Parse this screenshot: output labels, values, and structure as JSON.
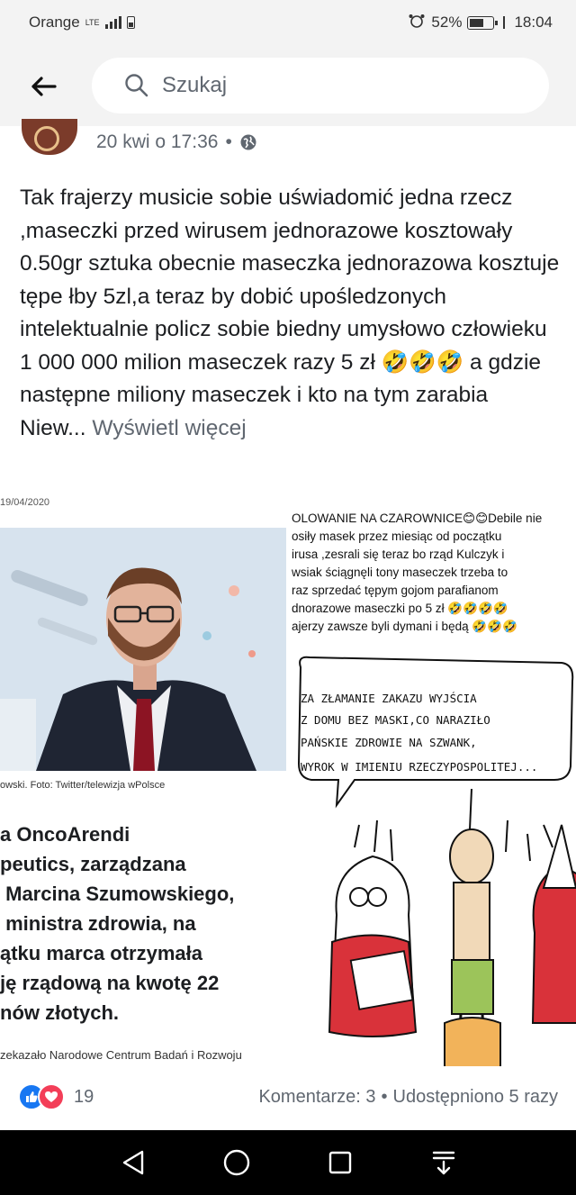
{
  "status_bar": {
    "carrier": "Orange",
    "network": "LTE",
    "battery_percent": "52%",
    "time": "18:04"
  },
  "header": {
    "search_placeholder": "Szukaj"
  },
  "post": {
    "timestamp": "20 kwi o 17:36",
    "separator": "•",
    "text": "Tak frajerzy musicie sobie uświadomić jedna rzecz ,maseczki przed wirusem jednorazowe kosztowały 0.50gr sztuka obecnie maseczka jednorazowa kosztuje tępe łby 5zl,a teraz by dobić upośledzonych intelektualnie policz sobie biedny umysłowo człowieku 1 000 000 milion maseczek razy 5 zł 🤣🤣🤣 a gdzie następne miliony maseczek i kto na tym zarabia Niew...",
    "see_more": "Wyświetl więcej"
  },
  "image": {
    "date": "19/04/2020",
    "photo_caption": "owski. Foto: Twitter/telewizja wPolsce",
    "headline": "a OncoArendi\npeutics, zarządzana\n Marcina Szumowskiego,\n ministra zdrowia, na\nątku marca otrzymała\nję rządową na kwotę 22\nnów złotych.",
    "source": "zekazało Narodowe Centrum Badań i Rozwoju",
    "right_caption": "OLOWANIE NA CZAROWNICE😊😊Debile nie\nosiły masek przez miesiąc od początku\nirusa ,zesrali się teraz bo rząd Kulczyk i\nwsiak ściągnęli tony maseczek trzeba to\nraz sprzedać tępym gojom parafianom\ndnorazowe maseczki po 5 zł 🤣🤣🤣🤣\najerzy zawsze byli dymani i będą 🤣🤣🤣",
    "bubble_lines": [
      "ZA ZŁAMANIE ZAKAZU WYJŚCIA",
      "Z DOMU BEZ MASKI,CO NARAZIŁO",
      "PAŃSKIE ZDROWIE NA SZWANK,",
      "WYROK W IMIENIU RZECZYPOSPOLITEJ..."
    ]
  },
  "reactions": {
    "count": "19",
    "comments": "Komentarze: 3",
    "dot": "•",
    "shares": "Udostępniono 5 razy"
  },
  "colors": {
    "like_blue": "#1877f2",
    "love_red": "#f33e58",
    "status_bg": "#f3f3f3"
  }
}
